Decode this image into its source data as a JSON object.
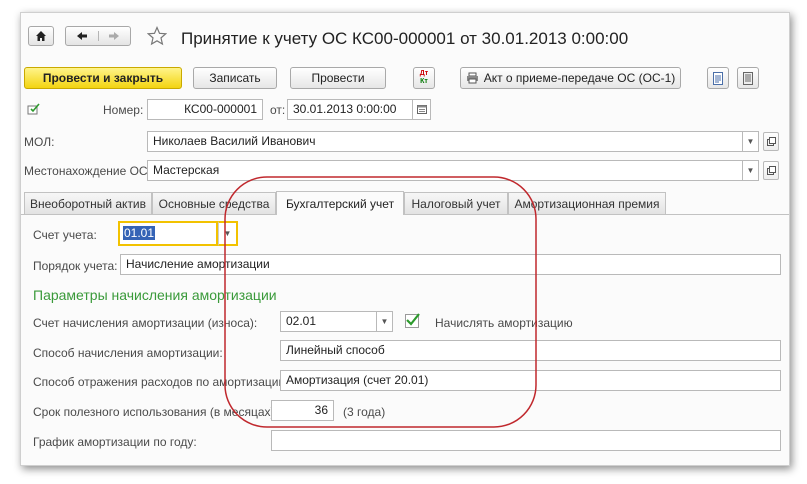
{
  "window": {
    "title": "Принятие к учету ОС КС00-000001 от 30.01.2013 0:00:00"
  },
  "nav": {
    "home_icon": "home-icon",
    "back_icon": "arrow-left-icon",
    "forward_icon": "arrow-right-icon",
    "favorite_icon": "star-icon"
  },
  "toolbar": {
    "post_close_label": "Провести и закрыть",
    "save_label": "Записать",
    "post_label": "Провести",
    "dt_kt_top": "Дт",
    "dt_kt_bottom": "Кт",
    "print_label": "Акт о приеме-передаче ОС (ОС-1)"
  },
  "header": {
    "number_label": "Номер:",
    "number_value": "КС00-000001",
    "date_label": "от:",
    "date_value": "30.01.2013  0:00:00",
    "mol_label": "МОЛ:",
    "mol_value": "Николаев Василий Иванович",
    "location_label": "Местонахождение ОС:",
    "location_value": "Мастерская"
  },
  "tabs": [
    {
      "label": "Внеоборотный актив"
    },
    {
      "label": "Основные средства"
    },
    {
      "label": "Бухгалтерский учет"
    },
    {
      "label": "Налоговый учет"
    },
    {
      "label": "Амортизационная премия"
    }
  ],
  "accounting": {
    "account_label": "Счет учета:",
    "account_value": "01.01",
    "order_label": "Порядок учета:",
    "order_value": "Начисление амортизации",
    "section_title": "Параметры начисления амортизации",
    "depr_account_label": "Счет начисления амортизации (износа):",
    "depr_account_value": "02.01",
    "accrue_checked": true,
    "accrue_label": "Начислять амортизацию",
    "method_label": "Способ начисления амортизации:",
    "method_value": "Линейный способ",
    "expense_label": "Способ отражения расходов по амортизации:",
    "expense_value": "Амортизация (счет 20.01)",
    "life_label": "Срок полезного использования (в месяцах):",
    "life_value": "36",
    "life_years": "(3 года)",
    "schedule_label": "График амортизации по году:",
    "schedule_value": ""
  },
  "colors": {
    "primary_button": "#f3d411",
    "section_title": "#3a9a3a",
    "annotation": "#c0282d",
    "focus_border": "#f2c200"
  }
}
